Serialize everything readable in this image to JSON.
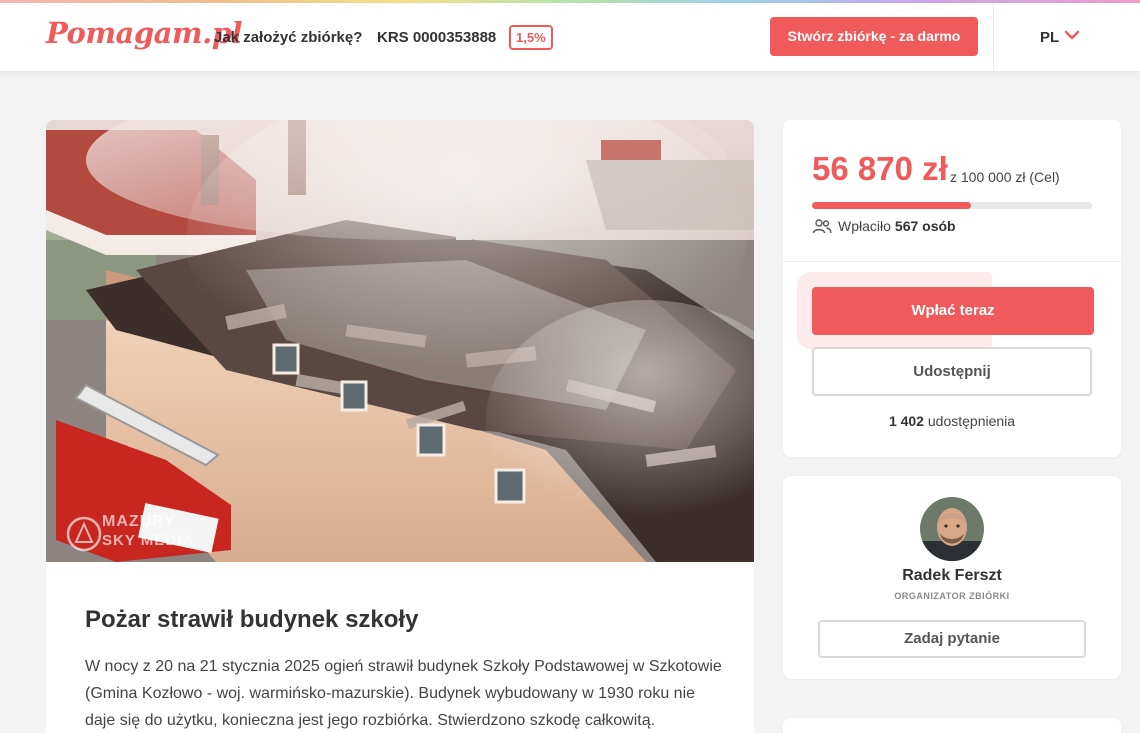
{
  "header": {
    "logo": "Pomagam.pl",
    "how_to_link": "Jak założyć zbiórkę?",
    "krs_text": "KRS 0000353888",
    "krs_badge": "1,5%",
    "create_button": "Stwórz zbiórkę - za darmo",
    "language": "PL"
  },
  "hero": {
    "watermark_line1": "MAZURY",
    "watermark_line2": "SKY MEDIA"
  },
  "campaign": {
    "title": "Pożar strawił budynek szkoły",
    "description": "W nocy z 20  na 21 stycznia 2025 ogień strawił budynek Szkoły Podstawowej w Szkotowie (Gmina Kozłowo - woj. warmińsko-mazurskie). Budynek wybudowany w 1930 roku nie daje się do użytku, konieczna jest jego rozbiórka. Stwierdzono szkodę całkowitą."
  },
  "donation": {
    "amount": "56 870 zł",
    "goal": "z 100 000 zł (Cel)",
    "progress_fraction": 0.5687,
    "donors_label": "Wpłaciło",
    "donors_count": "567 osób",
    "pay_button": "Wpłać teraz",
    "share_button": "Udostępnij",
    "shares_count": "1 402",
    "shares_label": "udostępnienia"
  },
  "organizer": {
    "name": "Radek Ferszt",
    "role": "ORGANIZATOR ZBIÓRKI",
    "ask_button": "Zadaj pytanie"
  },
  "colors": {
    "brand": "#f05a5b",
    "background": "#f3f3f3"
  }
}
